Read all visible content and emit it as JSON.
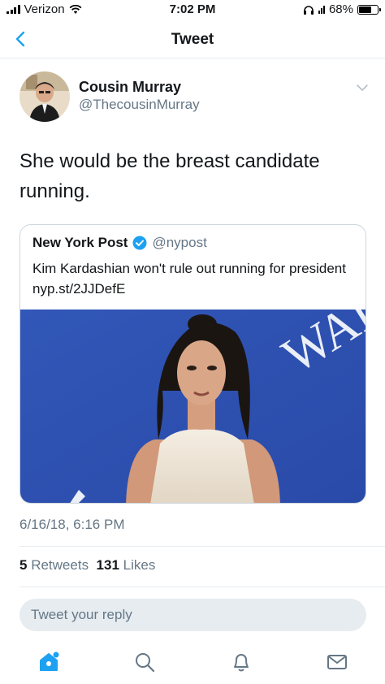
{
  "status_bar": {
    "carrier": "Verizon",
    "time": "7:02 PM",
    "battery": "68%",
    "battery_level": 0.68
  },
  "nav": {
    "title": "Tweet"
  },
  "tweet": {
    "author_name": "Cousin Murray",
    "author_handle": "@ThecousinMurray",
    "text": "She would be the breast candidate running.",
    "timestamp": "6/16/18, 6:16 PM"
  },
  "quote": {
    "name": "New York Post",
    "handle": "@nypost",
    "text": "Kim Kardashian won't rule out running for president nyp.st/2JJDefE",
    "image_text": "WAI"
  },
  "stats": {
    "retweets_count": "5",
    "retweets_label": "Retweets",
    "likes_count": "131",
    "likes_label": "Likes"
  },
  "reply": {
    "placeholder": "Tweet your reply"
  },
  "tabs": [
    "home-icon",
    "search-icon",
    "notifications-icon",
    "messages-icon"
  ],
  "colors": {
    "accent": "#1da1f2",
    "secondary_text": "#657786",
    "divider": "#e6ecf0"
  }
}
